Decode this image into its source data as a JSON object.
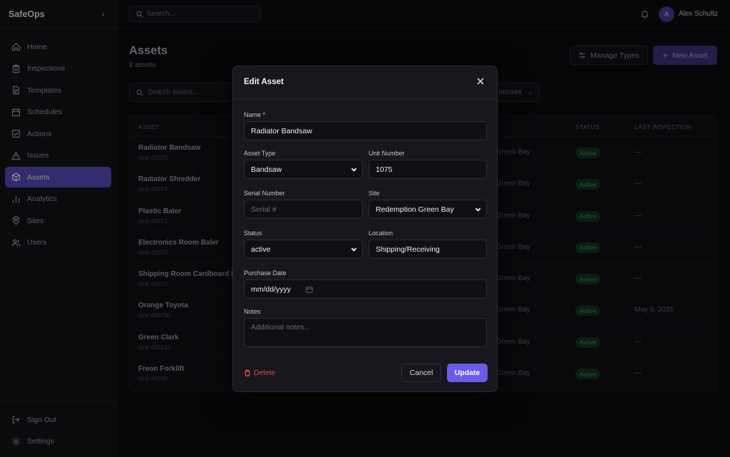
{
  "app": {
    "name": "SafeOps"
  },
  "topbar": {
    "search_placeholder": "Search...",
    "user_initial": "A",
    "user_name": "Alex Schultz"
  },
  "sidebar": {
    "items": [
      {
        "label": "Home",
        "icon": "home-icon"
      },
      {
        "label": "Inspections",
        "icon": "clipboard-icon"
      },
      {
        "label": "Templates",
        "icon": "document-icon"
      },
      {
        "label": "Schedules",
        "icon": "calendar-icon"
      },
      {
        "label": "Actions",
        "icon": "check-square-icon"
      },
      {
        "label": "Issues",
        "icon": "warning-icon"
      },
      {
        "label": "Assets",
        "icon": "box-icon",
        "active": true
      },
      {
        "label": "Analytics",
        "icon": "bar-chart-icon"
      },
      {
        "label": "Sites",
        "icon": "map-pin-icon"
      },
      {
        "label": "Users",
        "icon": "users-icon"
      }
    ],
    "bottom": [
      {
        "label": "Sign Out",
        "icon": "sign-out-icon"
      },
      {
        "label": "Settings",
        "icon": "gear-icon"
      }
    ]
  },
  "page": {
    "title": "Assets",
    "subtitle": "8 assets",
    "manage_types_label": "Manage Types",
    "new_asset_label": "New Asset",
    "search_placeholder": "Search assets...",
    "status_filter_label": "tatuses"
  },
  "table": {
    "headers": {
      "asset": "ASSET",
      "status": "STATUS",
      "last_inspection": "LAST INSPECTION"
    },
    "rows": [
      {
        "name": "Radiator Bandsaw",
        "unit": "Unit #1075",
        "site": "Green Bay",
        "status": "Active",
        "last": "—"
      },
      {
        "name": "Radiator Shredder",
        "unit": "Unit #1074",
        "site": "Green Bay",
        "status": "Active",
        "last": "—"
      },
      {
        "name": "Plastic Baler",
        "unit": "Unit #1071",
        "site": "Green Bay",
        "status": "Active",
        "last": "—"
      },
      {
        "name": "Electronics Room Baler",
        "unit": "Unit #1073",
        "site": "Green Bay",
        "status": "Active",
        "last": "—"
      },
      {
        "name": "Shipping Room Cardboard Ba",
        "unit": "Unit #1072",
        "site": "Green Bay",
        "status": "Active",
        "last": "—"
      },
      {
        "name": "Orange Toyota",
        "unit": "Unit #88790",
        "site": "Green Bay",
        "status": "Active",
        "last": "May 6, 2026"
      },
      {
        "name": "Green Clark",
        "unit": "Unit #22510",
        "site": "Green Bay",
        "status": "Active",
        "last": "—"
      },
      {
        "name": "Freon Forklift",
        "unit": "Unit #8200",
        "site": "Green Bay",
        "status": "Active",
        "last": "—"
      }
    ]
  },
  "modal": {
    "title": "Edit Asset",
    "name_label": "Name *",
    "name_value": "Radiator Bandsaw",
    "asset_type_label": "Asset Type",
    "asset_type_value": "Bandsaw",
    "unit_number_label": "Unit Number",
    "unit_number_value": "1075",
    "serial_label": "Serial Number",
    "serial_placeholder": "Serial #",
    "site_label": "Site",
    "site_value": "Redemption Green Bay",
    "status_label": "Status",
    "status_value": "active",
    "location_label": "Location",
    "location_value": "Shipping/Receiving",
    "purchase_label": "Purchase Date",
    "purchase_placeholder": "mm/dd/yyyy",
    "notes_label": "Notes",
    "notes_placeholder": "Additional notes...",
    "delete_label": "Delete",
    "cancel_label": "Cancel",
    "update_label": "Update"
  }
}
